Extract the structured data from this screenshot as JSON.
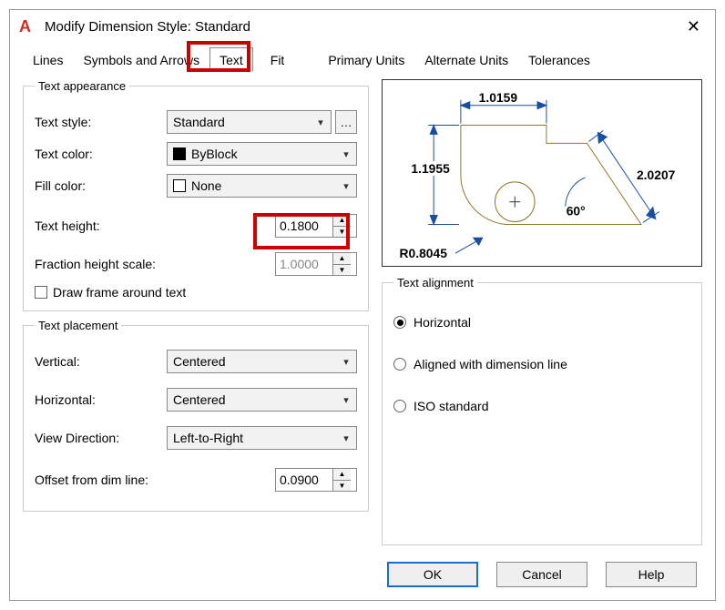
{
  "window": {
    "title": "Modify Dimension Style: Standard"
  },
  "tabs": {
    "lines": "Lines",
    "symbols": "Symbols and Arrows",
    "text": "Text",
    "fit": "Fit",
    "primary": "Primary Units",
    "alternate": "Alternate Units",
    "tolerances": "Tolerances"
  },
  "appearance": {
    "legend": "Text appearance",
    "text_style_label": "Text style:",
    "text_style_value": "Standard",
    "text_color_label": "Text color:",
    "text_color_value": "ByBlock",
    "fill_color_label": "Fill color:",
    "fill_color_value": "None",
    "text_height_label": "Text height:",
    "text_height_value": "0.1800",
    "fraction_label": "Fraction height scale:",
    "fraction_value": "1.0000",
    "draw_frame_label": "Draw frame around text"
  },
  "placement": {
    "legend": "Text placement",
    "vertical_label": "Vertical:",
    "vertical_value": "Centered",
    "horizontal_label": "Horizontal:",
    "horizontal_value": "Centered",
    "viewdir_label": "View Direction:",
    "viewdir_value": "Left-to-Right",
    "offset_label": "Offset from dim line:",
    "offset_value": "0.0900"
  },
  "alignment": {
    "legend": "Text alignment",
    "horizontal": "Horizontal",
    "aligned": "Aligned with dimension line",
    "iso": "ISO standard"
  },
  "preview": {
    "dim_top": "1.0159",
    "dim_left": "1.1955",
    "dim_diag": "2.0207",
    "angle": "60°",
    "radius": "R0.8045"
  },
  "buttons": {
    "ok": "OK",
    "cancel": "Cancel",
    "help": "Help"
  }
}
